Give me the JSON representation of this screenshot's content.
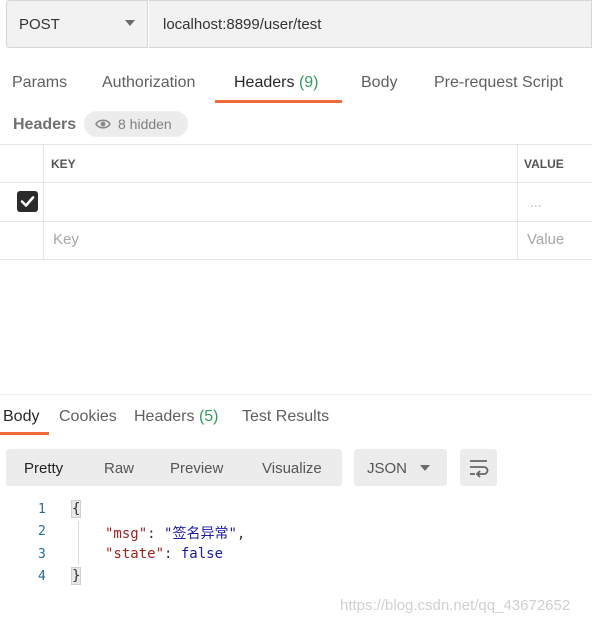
{
  "request": {
    "method": "POST",
    "url": "localhost:8899/user/test",
    "tabs": [
      {
        "label": "Params"
      },
      {
        "label": "Authorization"
      },
      {
        "label": "Headers",
        "count": "(9)"
      },
      {
        "label": "Body"
      },
      {
        "label": "Pre-request Script"
      }
    ],
    "active_tab": "Headers"
  },
  "headers_section": {
    "title": "Headers",
    "hidden": "8 hidden",
    "columns": [
      "KEY",
      "VALUE"
    ],
    "row_value": "...",
    "key_placeholder": "Key",
    "value_placeholder": "Value"
  },
  "response": {
    "tabs": [
      {
        "label": "Body"
      },
      {
        "label": "Cookies"
      },
      {
        "label": "Headers",
        "count": "(5)"
      },
      {
        "label": "Test Results"
      }
    ],
    "active_tab": "Body",
    "views": [
      "Pretty",
      "Raw",
      "Preview",
      "Visualize"
    ],
    "active_view": "Pretty",
    "format": "JSON",
    "code": {
      "line_numbers": [
        "1",
        "2",
        "3",
        "4"
      ],
      "open_brace": "{",
      "close_brace": "}",
      "msg_key": "\"msg\"",
      "msg_value": "\"签名异常\"",
      "state_key": "\"state\"",
      "state_value": "false",
      "colon": ": ",
      "comma": ","
    }
  },
  "watermark": "https://blog.csdn.net/qq_43672652",
  "colors": {
    "accent": "#f26b3a",
    "count": "#2e9e5a",
    "json_key": "#a3201f",
    "json_string": "#1a1aa6"
  }
}
